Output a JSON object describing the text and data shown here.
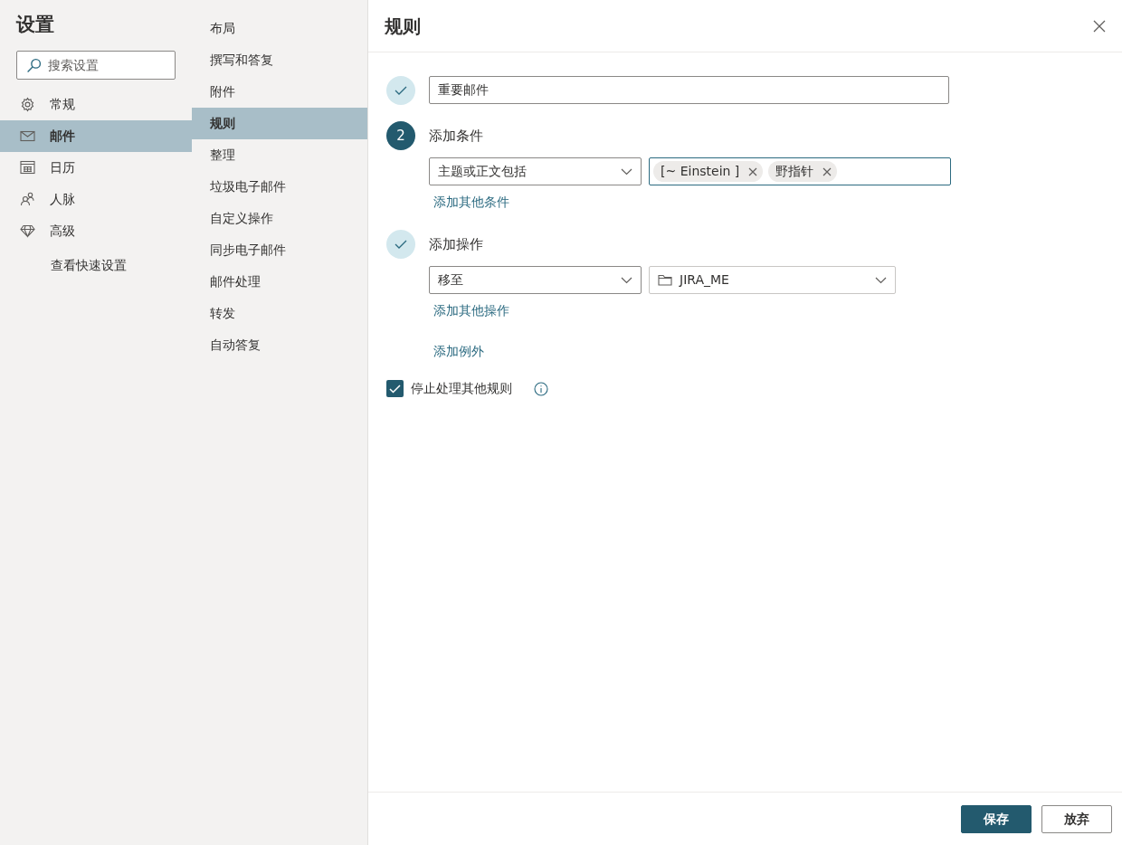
{
  "settings": {
    "title": "设置",
    "search": {
      "placeholder": "搜索设置"
    },
    "categories": [
      {
        "label": "常规",
        "selected": false
      },
      {
        "label": "邮件",
        "selected": true
      },
      {
        "label": "日历",
        "selected": false
      },
      {
        "label": "人脉",
        "selected": false
      },
      {
        "label": "高级",
        "selected": false
      }
    ],
    "quick_settings_link": "查看快速设置"
  },
  "subnav": [
    {
      "label": "布局",
      "selected": false
    },
    {
      "label": "撰写和答复",
      "selected": false
    },
    {
      "label": "附件",
      "selected": false
    },
    {
      "label": "规则",
      "selected": true
    },
    {
      "label": "整理",
      "selected": false
    },
    {
      "label": "垃圾电子邮件",
      "selected": false
    },
    {
      "label": "自定义操作",
      "selected": false
    },
    {
      "label": "同步电子邮件",
      "selected": false
    },
    {
      "label": "邮件处理",
      "selected": false
    },
    {
      "label": "转发",
      "selected": false
    },
    {
      "label": "自动答复",
      "selected": false
    }
  ],
  "panel": {
    "title": "规则",
    "steps": [
      {
        "kind": "name",
        "completed": true,
        "value": "重要邮件"
      },
      {
        "kind": "conditions",
        "completed": false,
        "number": "2",
        "heading": "添加条件",
        "select": "主题或正文包括",
        "tags": [
          "[~ Einstein ]",
          "野指针"
        ],
        "links": [
          "添加其他条件"
        ]
      },
      {
        "kind": "actions",
        "completed": true,
        "heading": "添加操作",
        "select": "移至",
        "folder": "JIRA_ME",
        "links": [
          "添加其他操作",
          "添加例外"
        ]
      }
    ],
    "stop_processing": {
      "label": "停止处理其他规则",
      "checked": true
    },
    "buttons": [
      {
        "label": "保存",
        "kind": "primary"
      },
      {
        "label": "放弃",
        "kind": "secondary"
      }
    ]
  }
}
